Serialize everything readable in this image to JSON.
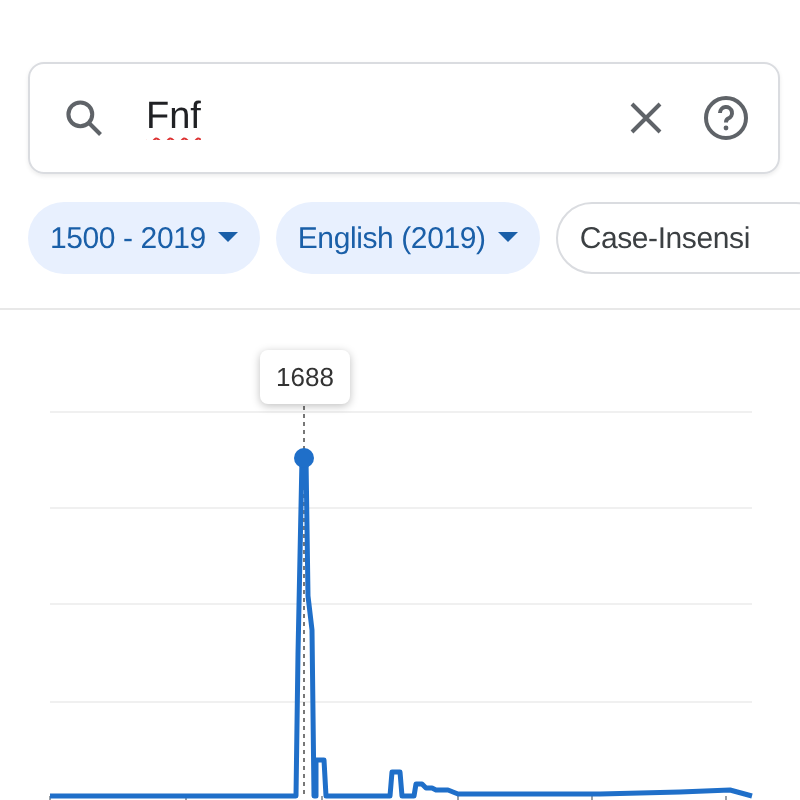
{
  "search": {
    "value": "Fnf"
  },
  "chips": [
    {
      "label": "1500 - 2019",
      "kind": "dropdown"
    },
    {
      "label": "English (2019)",
      "kind": "dropdown"
    },
    {
      "label": "Case-Insensi",
      "kind": "toggle"
    }
  ],
  "chart": {
    "tooltip": "1688"
  }
}
